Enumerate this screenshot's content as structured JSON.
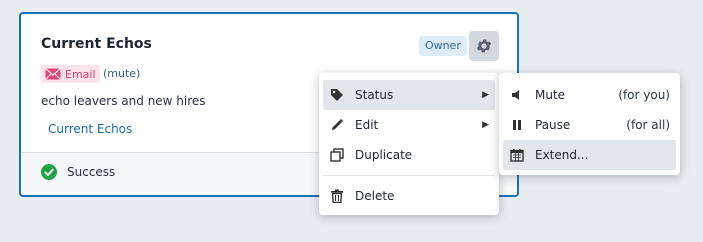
{
  "card": {
    "title": "Current Echos",
    "owner_badge": "Owner",
    "channel_label": "Email",
    "mute_note": "(mute)",
    "description": "echo leavers and new hires",
    "link_text": "Current Echos",
    "status_text": "Success"
  },
  "menu": {
    "items": [
      {
        "label": "Status",
        "icon": "tag-icon"
      },
      {
        "label": "Edit",
        "icon": "pencil-icon"
      },
      {
        "label": "Duplicate",
        "icon": "duplicate-icon"
      },
      {
        "label": "Delete",
        "icon": "trash-icon"
      }
    ]
  },
  "submenu": {
    "items": [
      {
        "label": "Mute",
        "hint": "(for you)",
        "icon": "speaker-icon"
      },
      {
        "label": "Pause",
        "hint": "(for all)",
        "icon": "pause-icon"
      },
      {
        "label": "Extend...",
        "hint": "",
        "icon": "calendar-icon"
      }
    ]
  },
  "colors": {
    "accent": "#1a73b8",
    "email_tag": "#d8376a",
    "success": "#24a148"
  }
}
